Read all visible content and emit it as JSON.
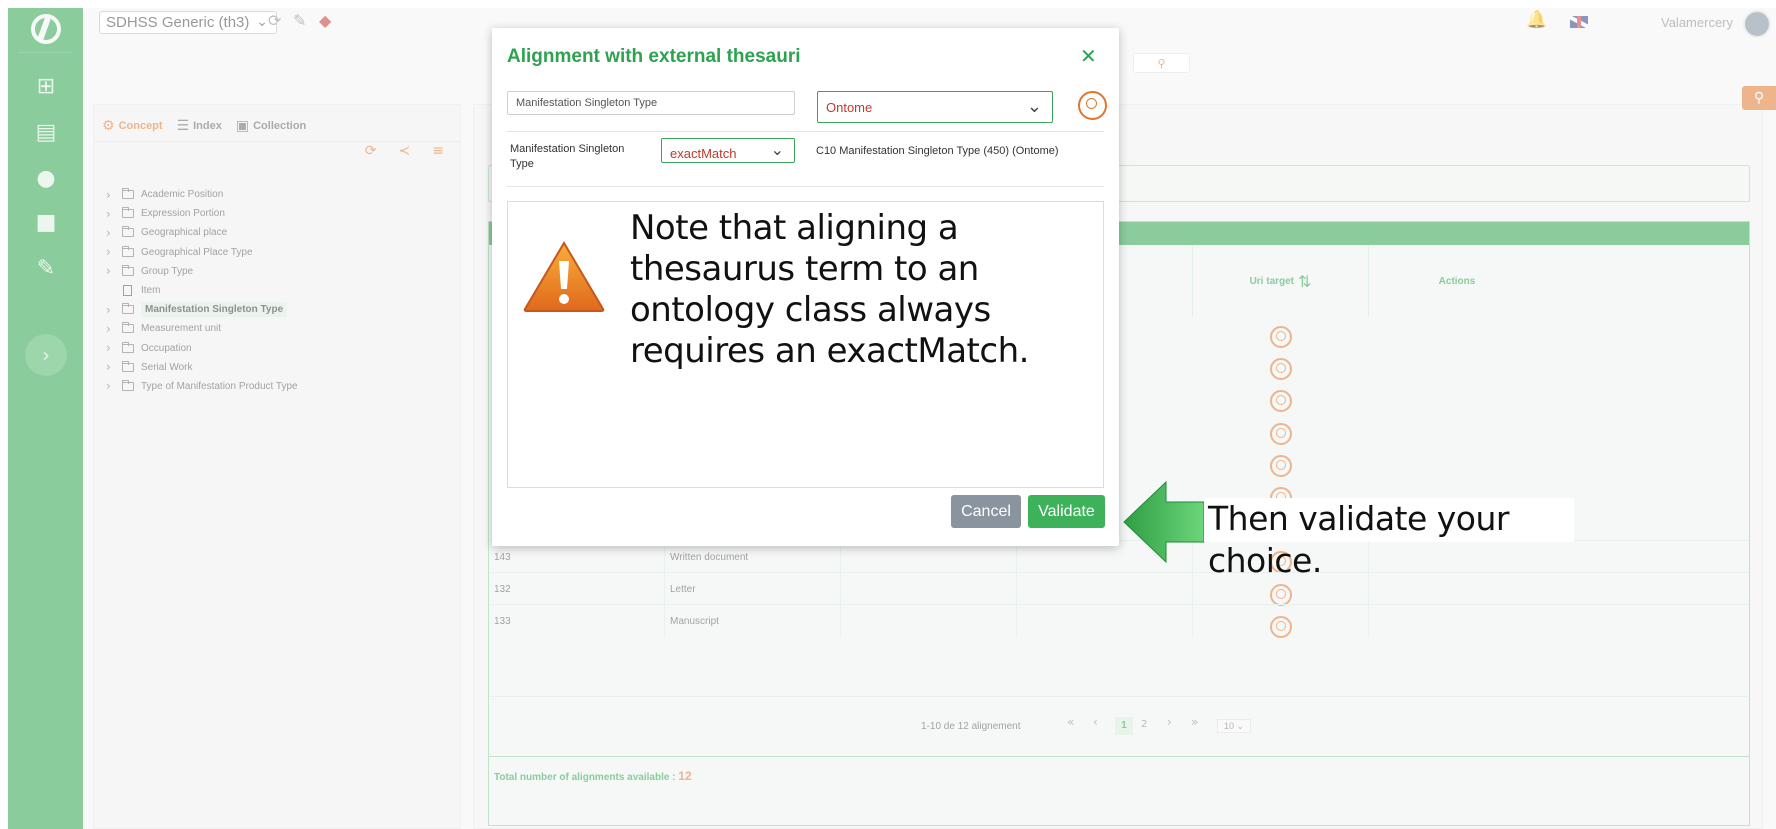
{
  "topbar": {
    "thesaurus": "SDHSS Generic (th3)",
    "user": "Valamercery"
  },
  "left_panel": {
    "tabs": [
      {
        "label": "Concept",
        "icon": "hierarchy-icon"
      },
      {
        "label": "Index",
        "icon": "list-icon"
      },
      {
        "label": "Collection",
        "icon": "collection-icon"
      }
    ],
    "tree": [
      {
        "label": "Academic Position",
        "type": "folder"
      },
      {
        "label": "Expression Portion",
        "type": "folder"
      },
      {
        "label": "Geographical place",
        "type": "folder"
      },
      {
        "label": "Geographical Place Type",
        "type": "folder"
      },
      {
        "label": "Group Type",
        "type": "folder"
      },
      {
        "label": "Item",
        "type": "file"
      },
      {
        "label": "Manifestation Singleton Type",
        "type": "folder",
        "selected": true
      },
      {
        "label": "Measurement unit",
        "type": "folder"
      },
      {
        "label": "Occupation",
        "type": "folder"
      },
      {
        "label": "Serial Work",
        "type": "folder"
      },
      {
        "label": "Type of Manifestation Product Type",
        "type": "folder"
      }
    ]
  },
  "table": {
    "headers": {
      "uri_target": "Uri target",
      "actions": "Actions"
    },
    "rows": [
      {
        "id": "143",
        "label": "Written document"
      },
      {
        "id": "132",
        "label": "Letter"
      },
      {
        "id": "133",
        "label": "Manuscript"
      }
    ],
    "pager": {
      "summary": "1-10 de 12 alignement",
      "first": "«",
      "prev": "‹",
      "current": "1",
      "next_page": "2",
      "next": "›",
      "last": "»",
      "per_page": "10 ⌄"
    },
    "total_label": "Total number of alignments available : ",
    "total_value": "12"
  },
  "modal": {
    "title": "Alignment with external thesauri",
    "search_value": "Manifestation Singleton Type",
    "source_select": "Ontome",
    "concept_label": "Manifestation Singleton Type",
    "match_type": "exactMatch",
    "result": "C10 Manifestation Singleton Type (450) (Ontome)",
    "cancel_label": "Cancel",
    "validate_label": "Validate"
  },
  "annotations": {
    "note": "Note that aligning a thesaurus term to an ontology class always requires an exactMatch.",
    "tip": "Then validate your choice."
  },
  "colors": {
    "brand_green": "#2aa24a",
    "accent_orange": "#e0772c",
    "validate_green": "#3db25a",
    "cancel_grey": "#8a949e"
  }
}
